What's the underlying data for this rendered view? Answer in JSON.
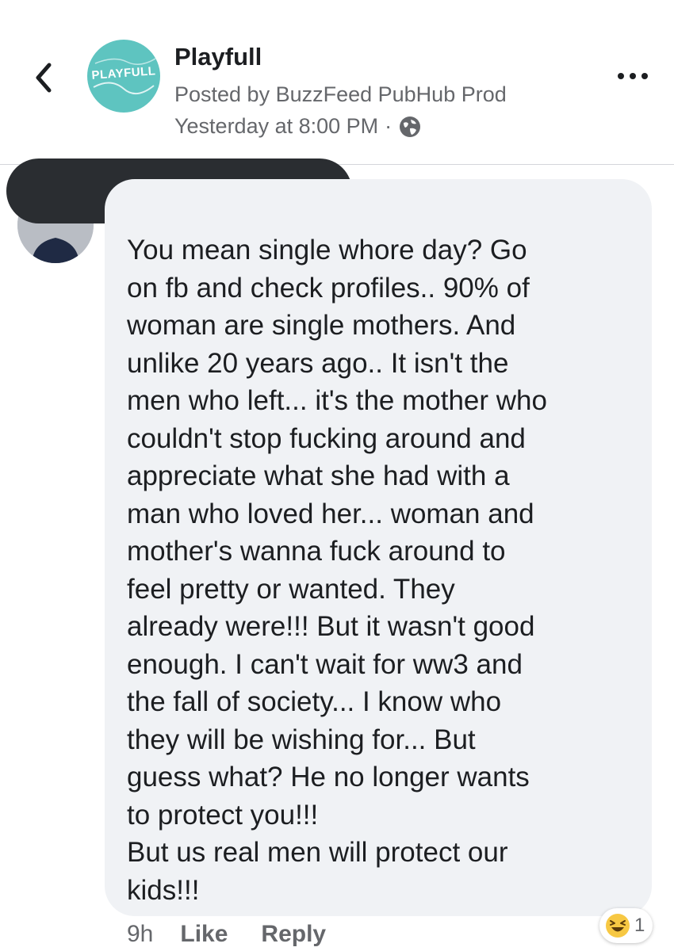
{
  "header": {
    "page_name": "Playfull",
    "logo_text": "PLAYFULL",
    "posted_by": "Posted by BuzzFeed PubHub Prod",
    "timestamp": "Yesterday at 8:00 PM",
    "separator": "·",
    "icons": {
      "back": "chevron-left-icon",
      "more": "more-dots-icon",
      "audience": "globe-icon"
    }
  },
  "comment": {
    "text": "You mean single whore day? Go\non fb and check profiles.. 90% of\nwoman are single mothers.  And\nunlike 20 years ago.. It isn't the\nmen who left... it's the mother who\ncouldn't stop fucking around and\nappreciate what she had with a\nman who loved her... woman and\nmother's wanna fuck around to\nfeel pretty or wanted. They\nalready were!!! But it wasn't good\nenough. I can't wait for ww3 and\nthe fall of society... I know who\nthey will be wishing for... But\nguess what? He no longer wants\nto protect you!!!\nBut us real men will protect our\nkids!!!",
    "time": "9h",
    "like_label": "Like",
    "reply_label": "Reply",
    "reaction": {
      "emoji": "laughing-emoji-icon",
      "count": "1"
    }
  },
  "colors": {
    "brand_teal": "#5ec4c0",
    "bubble_bg": "#f0f2f5",
    "secondary_text": "#65676b",
    "redaction": "#2a2d31"
  }
}
